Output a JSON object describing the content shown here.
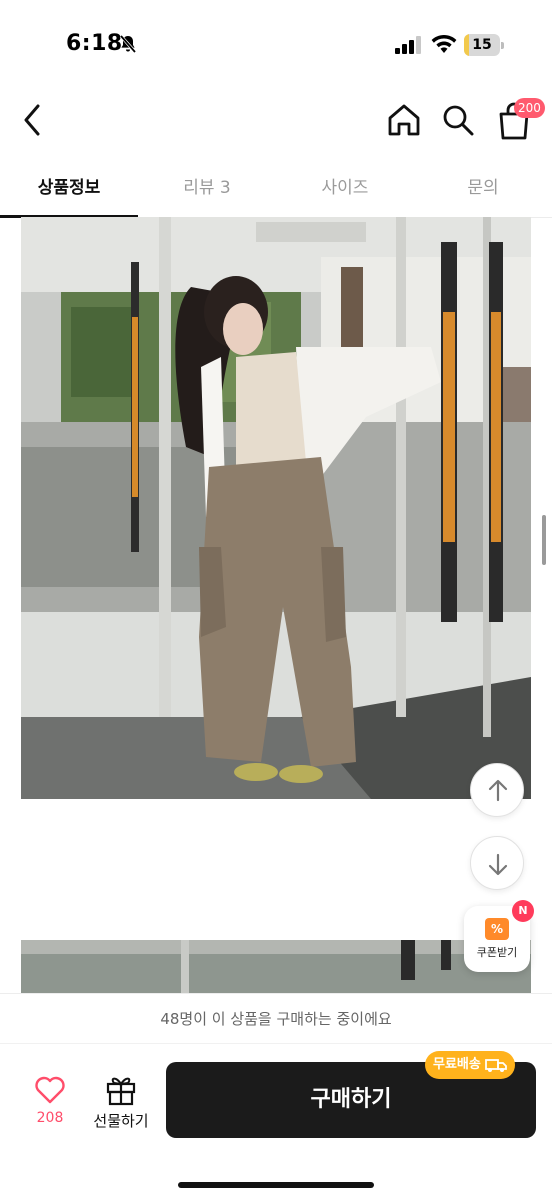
{
  "status_bar": {
    "time": "6:18",
    "battery_level": "15",
    "battery_fraction": 0.15
  },
  "header": {
    "cart_count": "200",
    "icons": [
      "back-icon",
      "home-icon",
      "search-icon",
      "cart-icon"
    ]
  },
  "tabs": [
    {
      "label": "상품정보",
      "active": true
    },
    {
      "label": "리뷰 3",
      "active": false
    },
    {
      "label": "사이즈",
      "active": false
    },
    {
      "label": "문의",
      "active": false
    }
  ],
  "floating": {
    "coupon_label": "쿠폰받기",
    "coupon_badge": "N"
  },
  "buyer_banner": "48명이 이 상품을 구매하는 중이에요",
  "bottom_bar": {
    "like_count": "208",
    "gift_label": "선물하기",
    "buy_label": "구매하기",
    "free_shipping": "무료배송"
  },
  "colors": {
    "accent_pink": "#ff4d6a",
    "badge": "#ff5a6e",
    "free_ship": "#ffb21c",
    "buy_button": "#1b1b1b"
  }
}
